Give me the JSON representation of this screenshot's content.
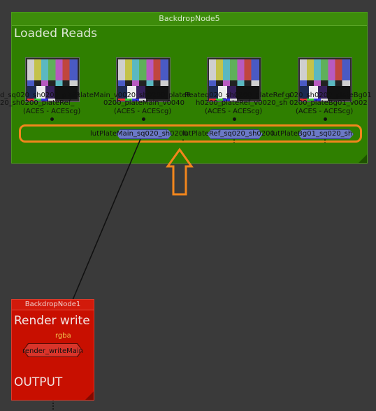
{
  "backdrop_green": {
    "header": "BackdropNode5",
    "title": "Loaded Reads"
  },
  "read_nodes": [
    {
      "line1": "d_sq020_sh0200_plate",
      "line2": "20_sh0200_plateRef_",
      "line3": "(ACES - ACEScg)"
    },
    {
      "line1": "RlateMain_v0020_sh0200_plateR",
      "line2": "0200_plateMain_v0040",
      "line3": "(ACES - ACEScg)"
    },
    {
      "line1": "Reateq020_sh0200_plateRef_s",
      "line2": "h0200_plateRef_v0020_sh",
      "line3": "(ACES - ACEScg)"
    },
    {
      "line1": "q020_sh0200_plateBg01",
      "line2": "0200_plateBg01_v002",
      "line3": "(ACES - ACEScg)"
    }
  ],
  "dot_nodes": [
    {
      "label": "lutPlateMain_sq020_sh0200"
    },
    {
      "label": "lutPlateRef_sq020_sh0200"
    },
    {
      "label": "lutPlateBg01_sq020_sh"
    }
  ],
  "backdrop_red": {
    "header": "BackdropNode1",
    "title": "Render write",
    "footer_title": "OUTPUT",
    "channel_label": "rgba",
    "write_node_label": "render_writeMain"
  },
  "thumb_label": "Macbeth"
}
